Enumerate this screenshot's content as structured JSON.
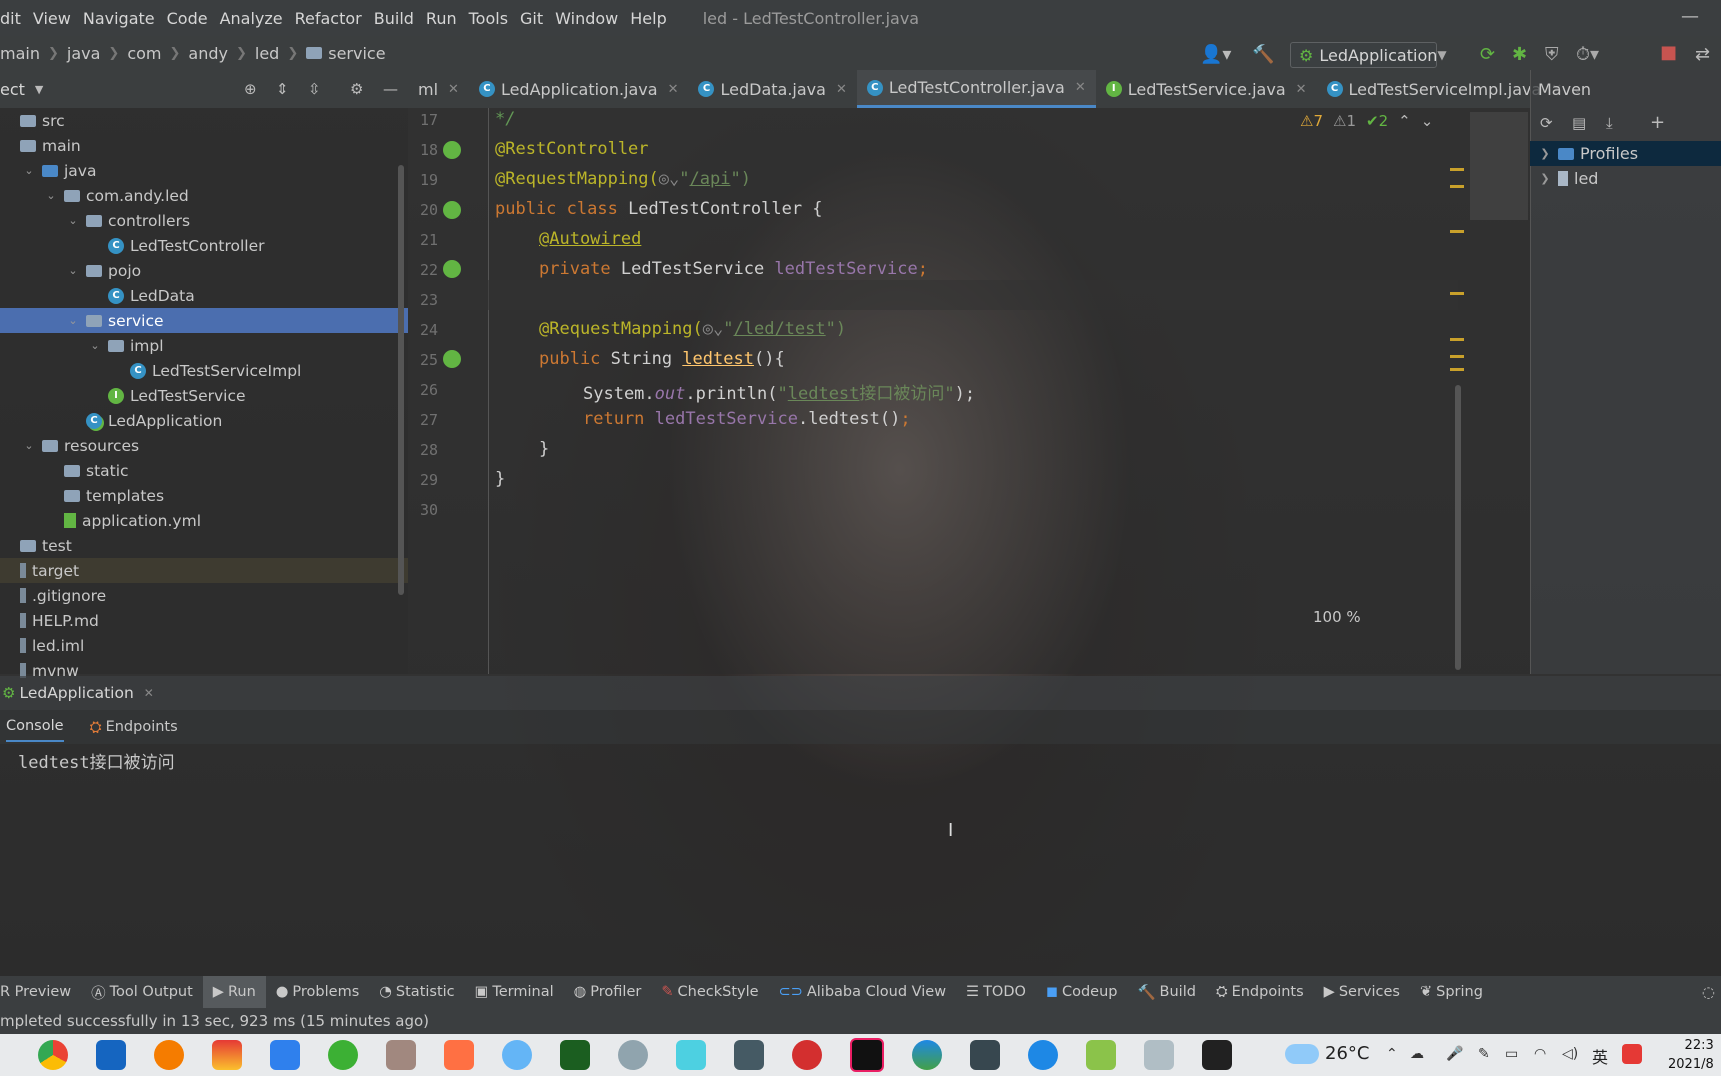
{
  "menu": [
    "dit",
    "View",
    "Navigate",
    "Code",
    "Analyze",
    "Refactor",
    "Build",
    "Run",
    "Tools",
    "Git",
    "Window",
    "Help"
  ],
  "window_title": "led - LedTestController.java",
  "breadcrumbs": [
    "main",
    "java",
    "com",
    "andy",
    "led",
    "service"
  ],
  "run_config": "LedApplication",
  "project_header": "ect",
  "tree": [
    {
      "label": "src",
      "depth": 0,
      "icon": "folder",
      "chev": ""
    },
    {
      "label": "main",
      "depth": 0,
      "icon": "folder",
      "chev": ""
    },
    {
      "label": "java",
      "depth": 1,
      "icon": "folder-blue",
      "chev": "v"
    },
    {
      "label": "com.andy.led",
      "depth": 2,
      "icon": "folder",
      "chev": "v"
    },
    {
      "label": "controllers",
      "depth": 3,
      "icon": "folder",
      "chev": "v"
    },
    {
      "label": "LedTestController",
      "depth": 4,
      "icon": "class",
      "chev": ""
    },
    {
      "label": "pojo",
      "depth": 3,
      "icon": "folder",
      "chev": "v"
    },
    {
      "label": "LedData",
      "depth": 4,
      "icon": "class",
      "chev": ""
    },
    {
      "label": "service",
      "depth": 3,
      "icon": "folder",
      "chev": "v"
    },
    {
      "label": "impl",
      "depth": 4,
      "icon": "folder",
      "chev": "v"
    },
    {
      "label": "LedTestServiceImpl",
      "depth": 5,
      "icon": "class",
      "chev": ""
    },
    {
      "label": "LedTestService",
      "depth": 4,
      "icon": "interface",
      "chev": ""
    },
    {
      "label": "LedApplication",
      "depth": 3,
      "icon": "app",
      "chev": ""
    },
    {
      "label": "resources",
      "depth": 1,
      "icon": "folder",
      "chev": "v"
    },
    {
      "label": "static",
      "depth": 2,
      "icon": "folder",
      "chev": ""
    },
    {
      "label": "templates",
      "depth": 2,
      "icon": "folder",
      "chev": ""
    },
    {
      "label": "application.yml",
      "depth": 2,
      "icon": "yml",
      "chev": ""
    },
    {
      "label": "test",
      "depth": 0,
      "icon": "folder",
      "chev": ""
    },
    {
      "label": "target",
      "depth": 0,
      "icon": "none",
      "chev": ""
    },
    {
      "label": ".gitignore",
      "depth": 0,
      "icon": "none",
      "chev": ""
    },
    {
      "label": "HELP.md",
      "depth": 0,
      "icon": "none",
      "chev": ""
    },
    {
      "label": "led.iml",
      "depth": 0,
      "icon": "none",
      "chev": ""
    },
    {
      "label": "mvnw",
      "depth": 0,
      "icon": "none",
      "chev": ""
    }
  ],
  "tabs": [
    {
      "label": "ml",
      "icon": ""
    },
    {
      "label": "LedApplication.java",
      "icon": "C"
    },
    {
      "label": "LedData.java",
      "icon": "C"
    },
    {
      "label": "LedTestController.java",
      "icon": "C"
    },
    {
      "label": "LedTestService.java",
      "icon": "I"
    },
    {
      "label": "LedTestServiceImpl.java",
      "icon": "C"
    }
  ],
  "line_numbers": [
    "17",
    "18",
    "19",
    "20",
    "21",
    "22",
    "23",
    "24",
    "25",
    "26",
    "27",
    "28",
    "29",
    "30"
  ],
  "code": {
    "l17": "*/",
    "l18": "@RestController",
    "l19a": "@RequestMapping(",
    "l19b": "\"",
    "l19c": "/api",
    "l19d": "\")",
    "l20a": "public class ",
    "l20b": "LedTestController {",
    "l21": "@Autowired",
    "l22a": "private ",
    "l22b": "LedTestService ",
    "l22c": "ledTestService",
    "l22d": ";",
    "l24a": "@RequestMapping(",
    "l24b": "\"",
    "l24c": "/led/test",
    "l24d": "\")",
    "l25a": "public ",
    "l25b": "String ",
    "l25c": "ledtest",
    "l25d": "(){",
    "l26a": "System.",
    "l26b": "out",
    "l26c": ".println(",
    "l26d": "\"",
    "l26e": "ledtest",
    "l26f": "接口被访问\"",
    "l26g": ");",
    "l27a": "return ",
    "l27b": "ledTestService",
    "l27c": ".ledtest()",
    "l27d": ";",
    "l28": "}",
    "l29": "}"
  },
  "inspections": {
    "warnings": "7",
    "weak": "1",
    "ok": "2"
  },
  "zoom": "100 %",
  "maven": {
    "title": "Maven",
    "items": [
      "Profiles",
      "led"
    ]
  },
  "run": {
    "config_tab": "LedApplication",
    "tabs": [
      "Console",
      "Endpoints"
    ],
    "output": "ledtest接口被访问"
  },
  "toolstrip": [
    "R Preview",
    "Tool Output",
    "Run",
    "Problems",
    "Statistic",
    "Terminal",
    "Profiler",
    "CheckStyle",
    "Alibaba Cloud View",
    "TODO",
    "Codeup",
    "Build",
    "Endpoints",
    "Services",
    "Spring"
  ],
  "status": "mpleted successfully in 13 sec, 923 ms (15 minutes ago)",
  "taskbar": {
    "weather": "26°C",
    "ime": "英",
    "time": "22:3",
    "date": "2021/8"
  }
}
